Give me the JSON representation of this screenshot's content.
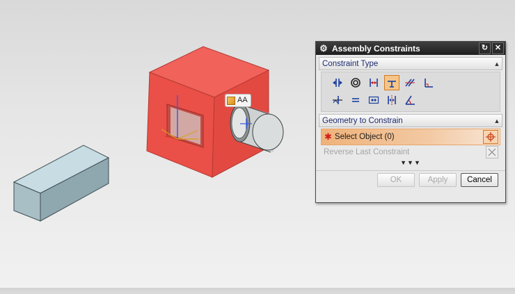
{
  "viewport": {
    "tag_label": "AA",
    "colors": {
      "red_part": "#ef5a4e",
      "gray_part": "#b9cfd6",
      "cylinder": "#d4d6d6"
    }
  },
  "dialog": {
    "title": "Assembly Constraints",
    "title_icons": [
      "gear-icon",
      "reset-icon",
      "close-icon"
    ],
    "constraint_type": {
      "header": "Constraint Type",
      "icons": [
        "touch-align-icon",
        "concentric-icon",
        "distance-icon",
        "fix-icon",
        "parallel-icon",
        "perpendicular-icon",
        "align-lock-icon",
        "fit-icon",
        "bond-icon",
        "center-icon",
        "angle-icon"
      ],
      "selected_icon": "fix-icon"
    },
    "geometry": {
      "header": "Geometry to Constrain",
      "select_object_label": "Select Object (0)",
      "reverse_label": "Reverse Last Constraint"
    },
    "buttons": {
      "ok": "OK",
      "apply": "Apply",
      "cancel": "Cancel"
    },
    "accent_color": "#d27a20"
  }
}
